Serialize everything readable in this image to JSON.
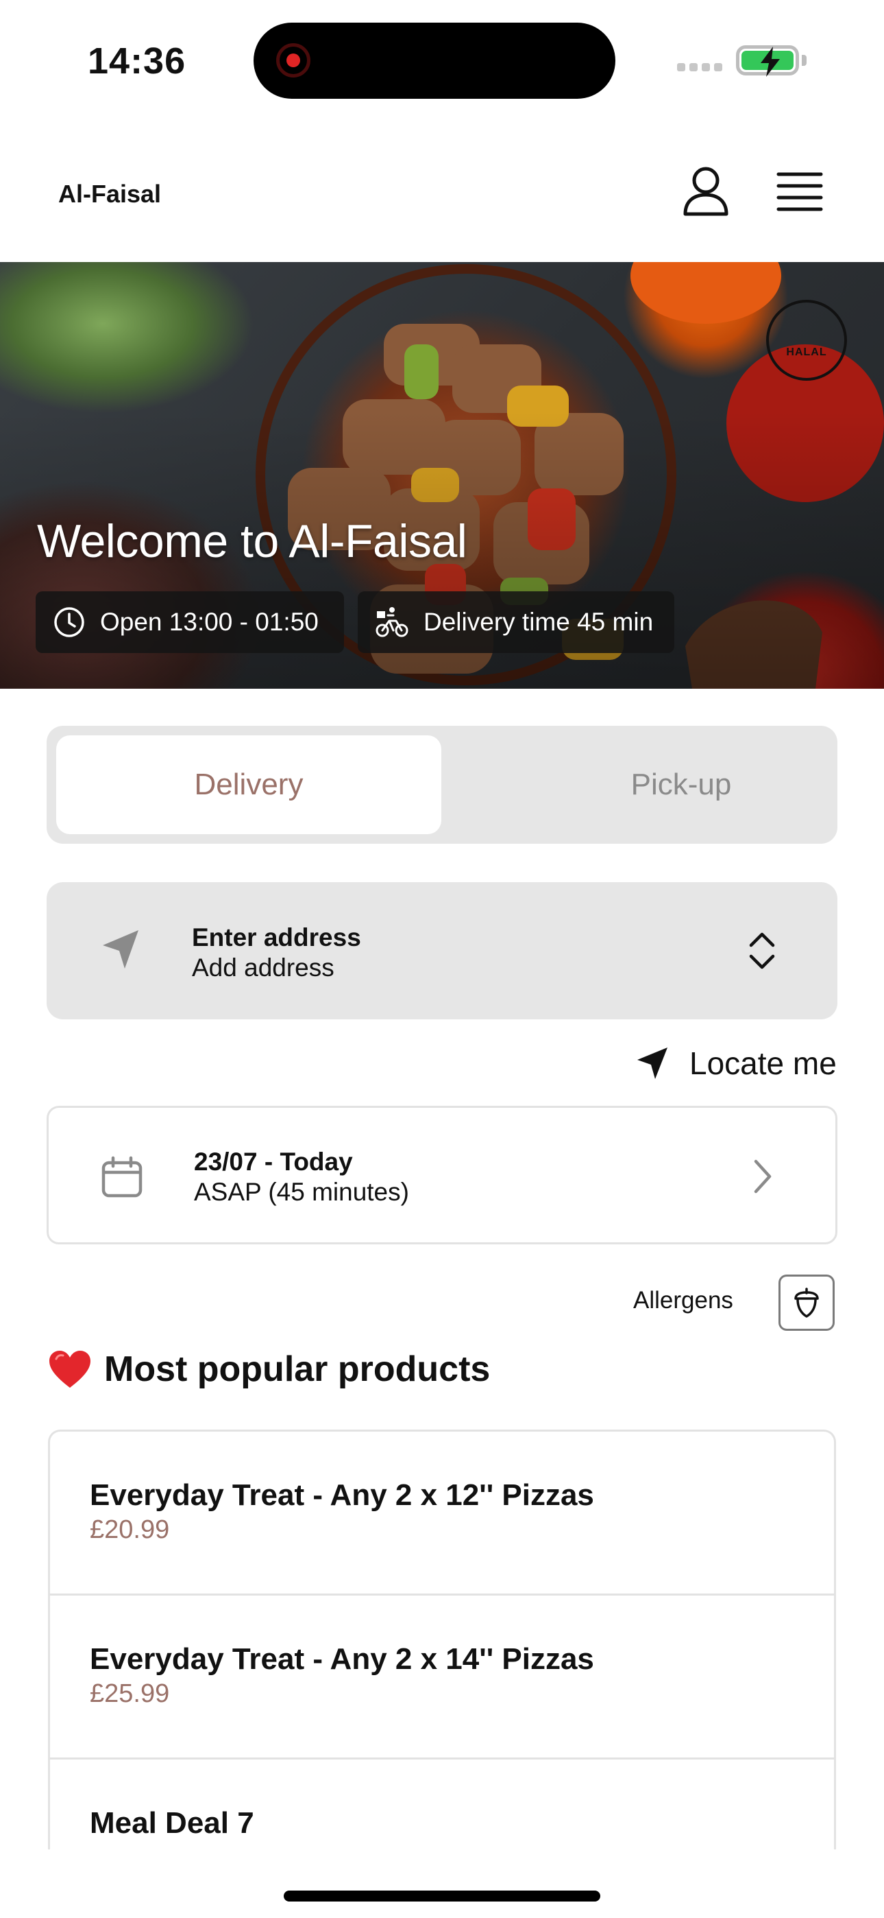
{
  "status_bar": {
    "time": "14:36"
  },
  "header": {
    "brand": "Al-Faisal"
  },
  "hero": {
    "title": "Welcome to Al-Faisal",
    "halal_badge": "HALAL",
    "open_hours": "Open 13:00 - 01:50",
    "delivery_time": "Delivery time 45 min"
  },
  "mode_toggle": {
    "options": [
      "Delivery",
      "Pick-up"
    ],
    "selected": "Delivery"
  },
  "address": {
    "title": "Enter address",
    "subtitle": "Add address"
  },
  "locate": {
    "label": "Locate me"
  },
  "schedule": {
    "date": "23/07 - Today",
    "time": "ASAP (45 minutes)"
  },
  "allergens": {
    "label": "Allergens"
  },
  "popular": {
    "title": "Most popular products",
    "products": [
      {
        "name": "Everyday Treat - Any 2 x 12'' Pizzas",
        "price": "£20.99"
      },
      {
        "name": "Everyday Treat - Any 2 x 14'' Pizzas",
        "price": "£25.99"
      },
      {
        "name": "Meal Deal 7",
        "price": ""
      }
    ]
  },
  "icons": {
    "user": "user-icon",
    "menu": "hamburger-menu-icon",
    "clock": "clock-icon",
    "bike": "bike-delivery-icon",
    "navigation": "navigation-arrow-icon",
    "expand": "chevron-up-down-icon",
    "calendar": "calendar-icon",
    "chevron": "chevron-right-icon",
    "acorn": "acorn-icon",
    "heart": "heart-icon"
  },
  "colors": {
    "accent": "#9a7168",
    "toggle_bg": "#e6e6e6",
    "chip_bg": "#141414",
    "battery": "#34c759"
  }
}
